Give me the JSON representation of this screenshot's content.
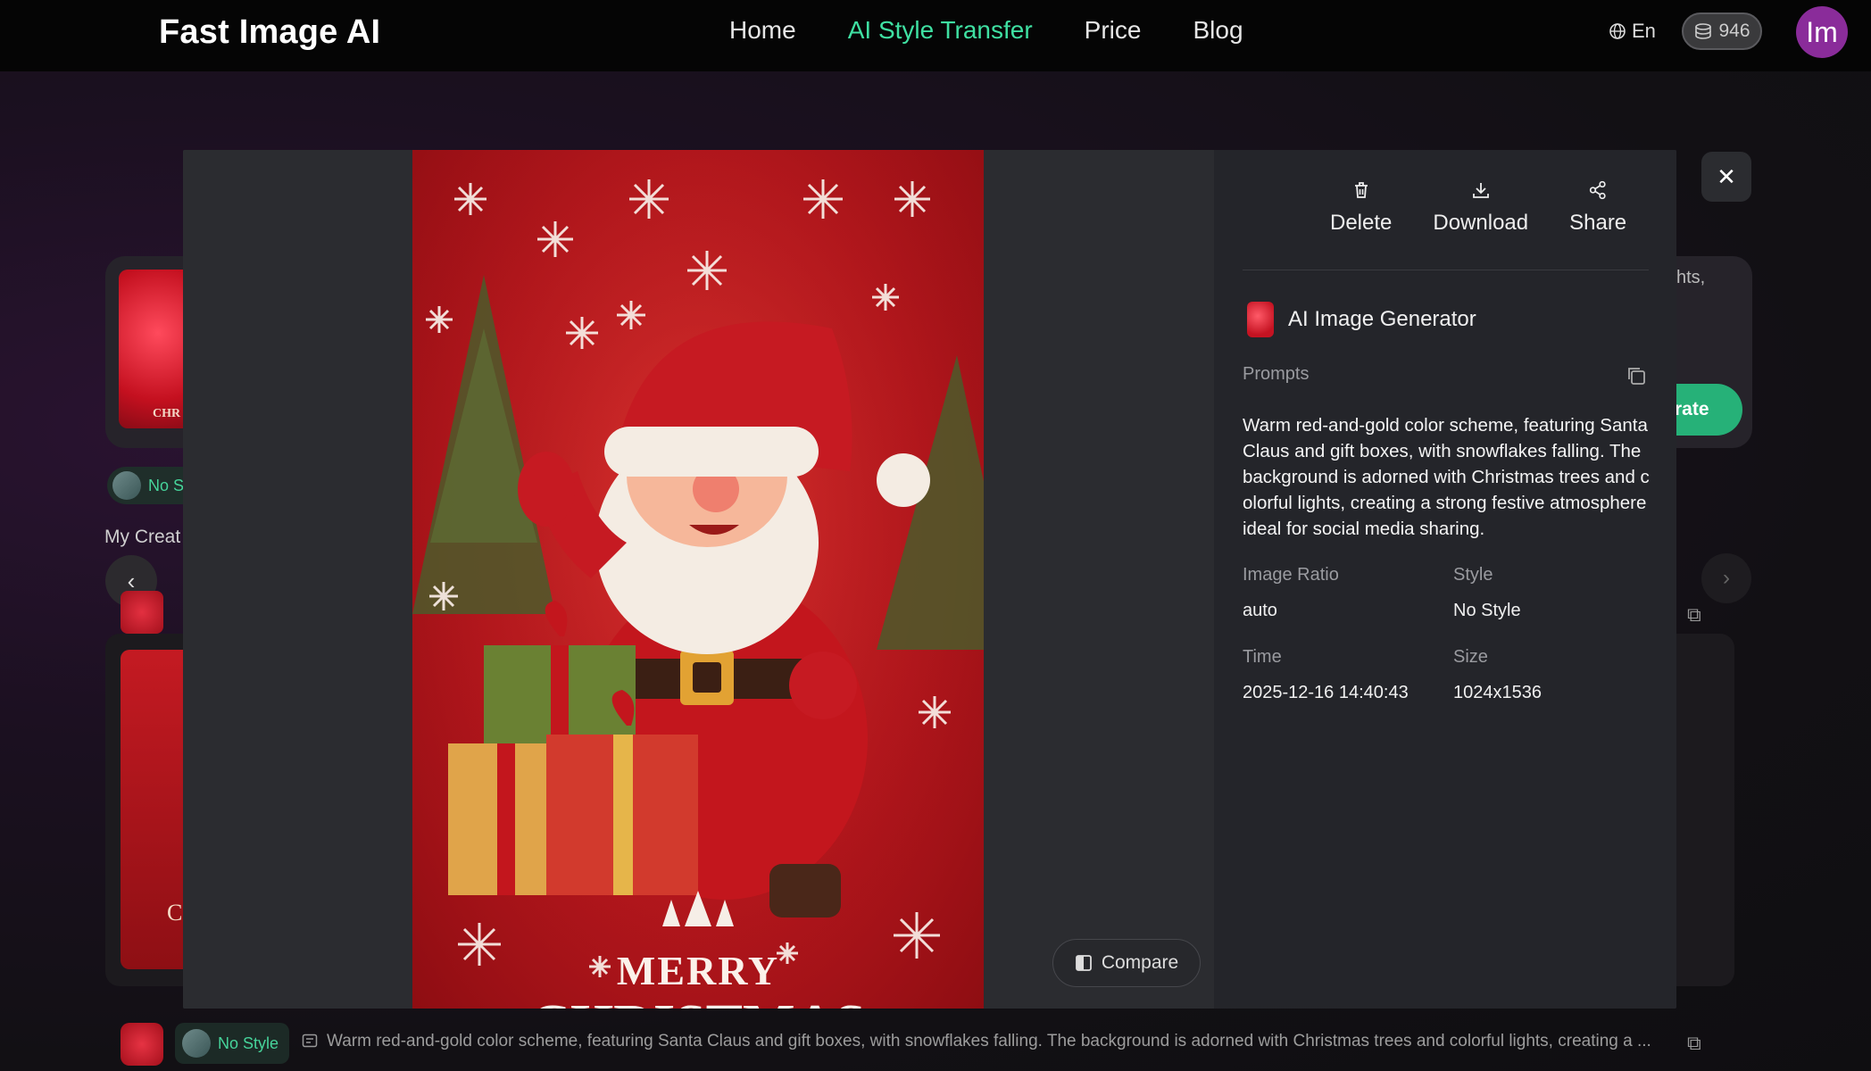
{
  "header": {
    "logo": "Fast Image AI",
    "nav": [
      "Home",
      "AI Style Transfer",
      "Price",
      "Blog"
    ],
    "active_nav": "AI Style Transfer",
    "language": "En",
    "credits": "946",
    "avatar_initials": "Im"
  },
  "background": {
    "thumb_text": "CHR",
    "style_pill": "No S",
    "my_creations": "My Creat",
    "generate_partial": "rate",
    "text_partial": "hts,",
    "tall_thumb_text": "C",
    "bottom_style": "No Style",
    "bottom_prompt": "Warm red-and-gold color scheme, featuring Santa Claus and gift boxes, with snowflakes falling. The background is adorned with Christmas trees and colorful lights, creating a ..."
  },
  "modal": {
    "poster": {
      "line1": "MERRY",
      "line2": "CHRISTMAS"
    },
    "compare_label": "Compare",
    "actions": {
      "delete": "Delete",
      "download": "Download",
      "share": "Share"
    },
    "generator": "AI Image Generator",
    "prompts_label": "Prompts",
    "prompt_text": "Warm red-and-gold color scheme, featuring Santa Claus and gift boxes, with snowflakes falling. The background is adorned with Christmas trees and colorful lights, creating a strong festive atmosphere ideal for social media sharing.",
    "image_ratio_label": "Image Ratio",
    "image_ratio": "auto",
    "style_label": "Style",
    "style": "No Style",
    "time_label": "Time",
    "time": "2025-12-16 14:40:43",
    "size_label": "Size",
    "size": "1024x1536"
  },
  "colors": {
    "accent": "#3fe0a2",
    "generate": "#26b178",
    "avatar": "#8a2c9a"
  }
}
